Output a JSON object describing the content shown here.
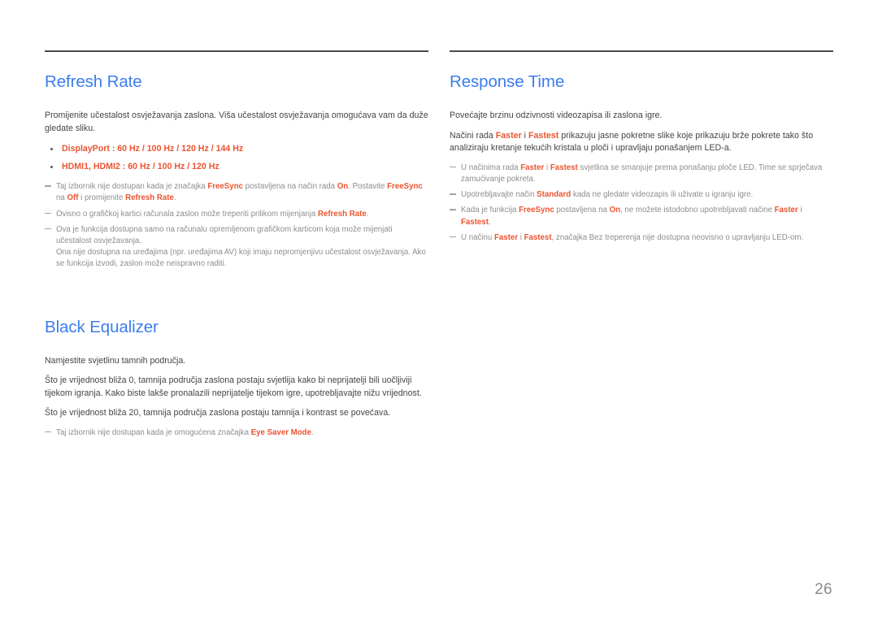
{
  "page": {
    "number": "26"
  },
  "left_column": {
    "sections": [
      {
        "title": "Refresh Rate",
        "intro": "Promijenite učestalost osvježavanja zaslona. Viša učestalost osvježavanja omogućava vam da duže gledate sliku.",
        "bullets": [
          "DisplayPort : 60 Hz / 100 Hz / 120 Hz / 144 Hz",
          "HDMI1, HDMI2 : 60 Hz / 100 Hz / 120 Hz"
        ],
        "notes": [
          {
            "pre": "Taj izbornik nije dostupan kada je značajka ",
            "t1": "FreeSync",
            "mid1": " postavljena na način rada ",
            "t2": "On",
            "mid2": ". Postavite ",
            "t3": "FreeSync",
            "mid3": " na ",
            "t4": "Off",
            "mid4": " i promijenite ",
            "t5": "Refresh Rate",
            "post": "."
          },
          {
            "pre": "Ovisno o grafičkoj kartici računala zaslon može treperiti prilikom mijenjanja ",
            "t1": "Refresh Rate",
            "post": "."
          },
          {
            "pre": "Ova je funkcija dostupna samo na računalu opremljenom grafičkom karticom koja može mijenjati učestalost osvježavanja.",
            "subline": "Ona nije dostupna na uređajima (npr. uređajima AV) koji imaju nepromjenjivu učestalost osvježavanja. Ako se funkcija izvodi, zaslon može neispravno raditi."
          }
        ]
      },
      {
        "title": "Black Equalizer",
        "paragraphs": [
          "Namjestite svjetlinu tamnih područja.",
          "Što je vrijednost bliža 0, tamnija područja zaslona postaju svjetlija kako bi neprijatelji bili uočljiviji tijekom igranja. Kako biste lakše pronalazili neprijatelje tijekom igre, upotrebljavajte nižu vrijednost.",
          "Što je vrijednost bliža 20, tamnija područja zaslona postaju tamnija i kontrast se povećava."
        ],
        "notes": [
          {
            "pre": "Taj izbornik nije dostupan kada je omogućena značajka ",
            "t1": "Eye Saver Mode",
            "post": "."
          }
        ]
      }
    ]
  },
  "right_column": {
    "sections": [
      {
        "title": "Response Time",
        "intro": "Povećajte brzinu odzivnosti videozapisa ili zaslona igre.",
        "para2": {
          "pre": "Načini rada ",
          "t1": "Faster",
          "mid1": " i ",
          "t2": "Fastest",
          "post": " prikazuju jasne pokretne slike koje prikazuju brže pokrete tako što analiziraju kretanje tekućih kristala u ploči i upravljaju ponašanjem LED-a."
        },
        "notes": [
          {
            "pre": "U načinima rada ",
            "t1": "Faster",
            "mid1": " i ",
            "t2": "Fastest",
            "post": " svjetlina se smanjuje prema ponašanju ploče LED. Time se sprječava zamućivanje pokreta."
          },
          {
            "pre": "Upotrebljavajte način ",
            "t1": "Standard",
            "post": " kada ne gledate videozapis ili uživate u igranju igre."
          },
          {
            "pre": "Kada je funkcija ",
            "t1": "FreeSync",
            "mid1": " postavljena na ",
            "t2": "On",
            "mid2": ", ne možete istodobno upotrebljavati načine ",
            "t3": "Faster",
            "mid3": " i ",
            "t4": "Fastest",
            "post": "."
          },
          {
            "pre": "U načinu ",
            "t1": "Faster",
            "mid1": " i ",
            "t2": "Fastest",
            "post": ", značajka Bez treperenja nije dostupna neovisno o upravljanju LED-om."
          }
        ]
      }
    ]
  },
  "theme": {
    "heading_color": "#3c7ded",
    "accent_color": "#ea5532",
    "body_color": "#444444",
    "note_color": "#8d8d8d",
    "rule_color": "#4a4a4a"
  }
}
